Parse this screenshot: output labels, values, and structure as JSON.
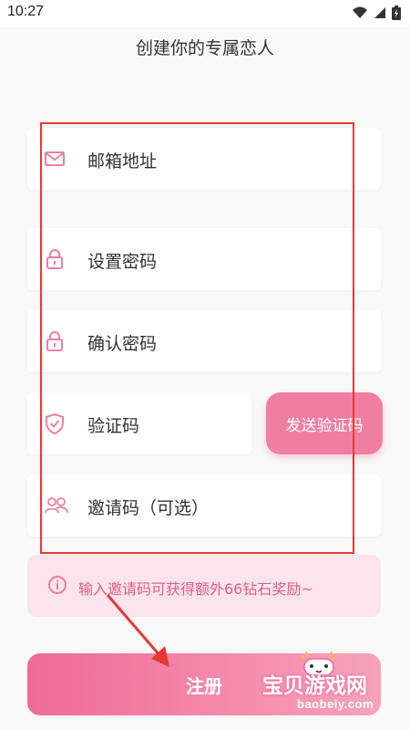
{
  "status_bar": {
    "time": "10:27"
  },
  "header": {
    "title": "创建你的专属恋人"
  },
  "form": {
    "email_placeholder": "邮箱地址",
    "password_placeholder": "设置密码",
    "confirm_placeholder": "确认密码",
    "code_placeholder": "验证码",
    "send_code_label": "发送验证码",
    "invite_placeholder": "邀请码（可选）"
  },
  "tip": {
    "text": "输入邀请码可获得额外66钻石奖励~"
  },
  "submit": {
    "label": "注册"
  },
  "watermark": {
    "title": "宝贝游戏网",
    "site": "baobeiy.com"
  },
  "colors": {
    "accent": "#f07ea0",
    "tip_bg": "#fbe4ec",
    "annotation": "#e53935"
  }
}
